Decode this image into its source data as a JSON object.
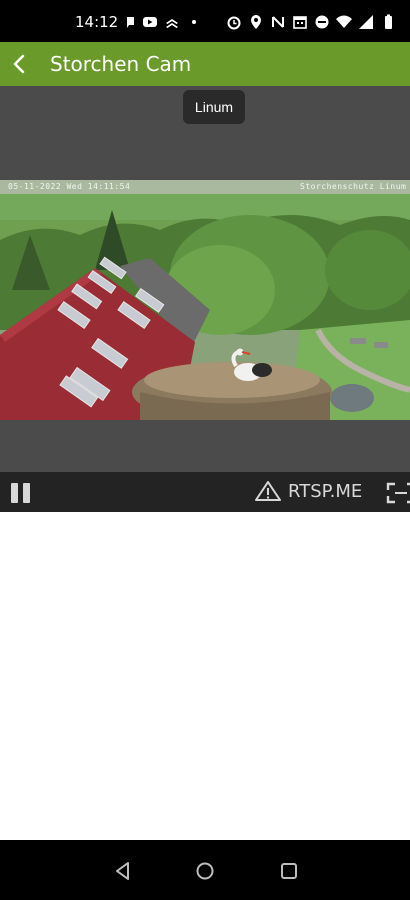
{
  "status_bar": {
    "time": "14:12",
    "icons_left": [
      "cast-icon",
      "youtube-icon",
      "stacks-icon",
      "dot-icon"
    ],
    "icons_right": [
      "alarm-icon",
      "location-icon",
      "nfc-icon",
      "calendar-icon",
      "dnd-icon",
      "wifi-icon",
      "signal-icon",
      "battery-icon"
    ]
  },
  "app_bar": {
    "title": "Storchen Cam",
    "back_icon": "arrow-left-icon",
    "background": "#6a9a2a"
  },
  "video": {
    "tooltip": "Linum",
    "osd_left": "05-11-2022 Wed 14:11:54",
    "osd_right": "Storchenschutz Linum"
  },
  "controls": {
    "pause_icon": "pause-icon",
    "brand": "RTSP.ME",
    "warning_icon": "warning-icon",
    "fullscreen_icon": "fullscreen-icon"
  },
  "nav_bar": {
    "back": "back-triangle-icon",
    "home": "home-circle-icon",
    "recents": "recents-square-icon"
  }
}
